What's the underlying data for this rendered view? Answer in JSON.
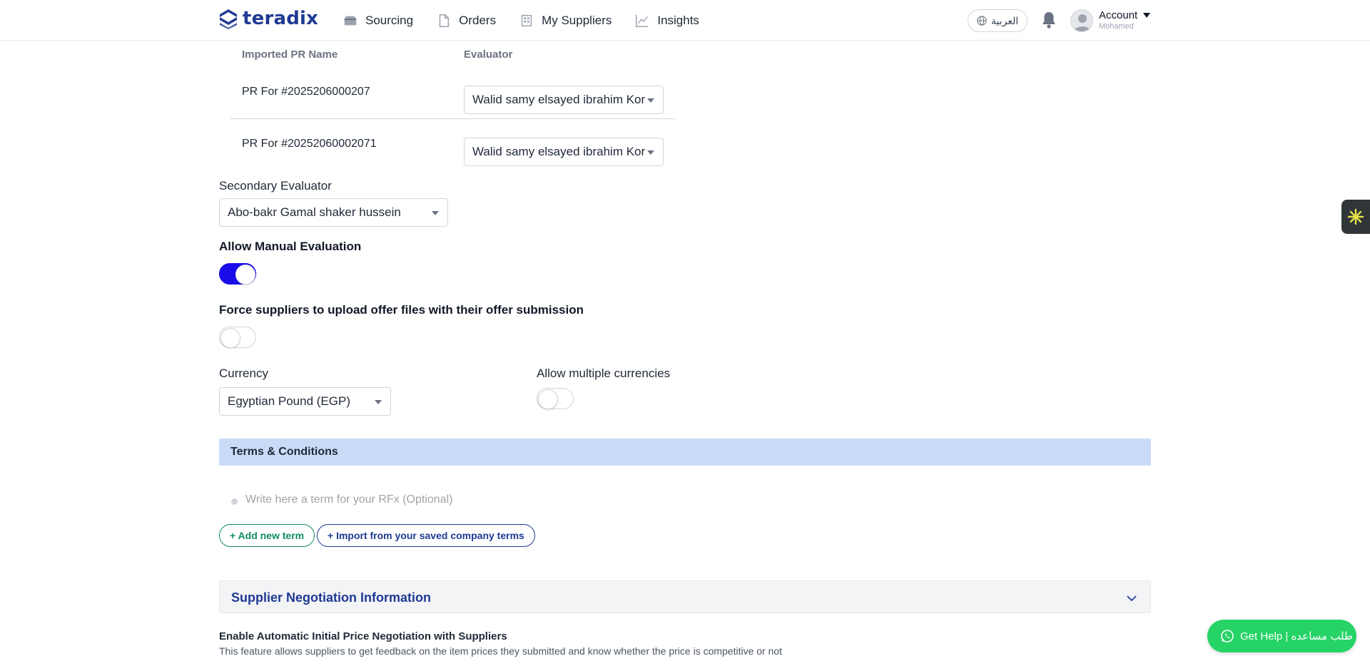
{
  "header": {
    "brand": "teradix",
    "nav": [
      {
        "label": "Sourcing"
      },
      {
        "label": "Orders"
      },
      {
        "label": "My Suppliers"
      },
      {
        "label": "Insights"
      }
    ],
    "language_label": "العربية",
    "account_label": "Account",
    "account_user": "Mohamed"
  },
  "evaluators": {
    "col_name": "Imported PR Name",
    "col_evaluator": "Evaluator",
    "rows": [
      {
        "name": "PR For #2025206000207",
        "evaluator": "Walid samy elsayed ibrahim Kor"
      },
      {
        "name": "PR For #20252060002071",
        "evaluator": "Walid samy elsayed ibrahim Kor"
      }
    ]
  },
  "secondary_evaluator": {
    "label": "Secondary Evaluator",
    "value": "Abo-bakr Gamal shaker hussein"
  },
  "manual_evaluation": {
    "label": "Allow Manual Evaluation",
    "enabled": true
  },
  "force_upload": {
    "label": "Force suppliers to upload offer files with their offer submission",
    "enabled": false
  },
  "currency": {
    "label": "Currency",
    "value": "Egyptian Pound (EGP)"
  },
  "multi_currency": {
    "label": "Allow multiple currencies",
    "enabled": false
  },
  "terms": {
    "title": "Terms & Conditions",
    "placeholder": "Write here a term for your RFx (Optional)",
    "add_label": "+ Add new term",
    "import_label": "+ Import from your saved company terms"
  },
  "negotiation": {
    "section_title": "Supplier Negotiation Information",
    "feature_title": "Enable Automatic Initial Price Negotiation with Suppliers",
    "feature_desc": "This feature allows suppliers to get feedback on the item prices they submitted and know whether the price is competitive or not"
  },
  "help": {
    "label": "Get Help | طلب مساعده"
  },
  "colors": {
    "brand": "#1f3a93",
    "toggle_on": "#1a0ce8",
    "terms_bar": "#c9dbf7",
    "help": "#25d366"
  }
}
